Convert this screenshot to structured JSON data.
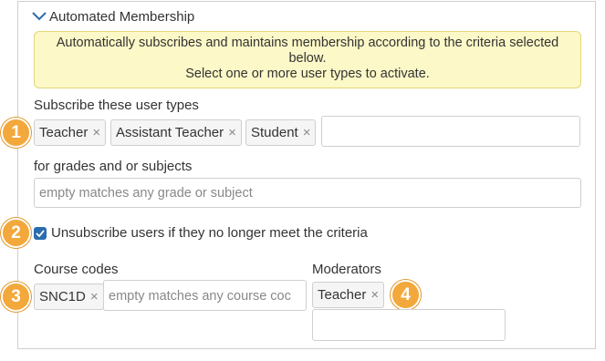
{
  "section": {
    "title": "Automated Membership"
  },
  "info": {
    "line1": "Automatically subscribes and maintains membership according to the criteria selected",
    "line2": "below.",
    "line3": "Select one or more user types to activate."
  },
  "user_types": {
    "label": "Subscribe these user types",
    "tags": [
      "Teacher",
      "Assistant Teacher",
      "Student"
    ]
  },
  "grades": {
    "label": "for grades and or subjects",
    "placeholder": "empty matches any grade or subject"
  },
  "unsubscribe": {
    "label": "Unsubscribe users if they no longer meet the criteria",
    "checked": true
  },
  "course_codes": {
    "label": "Course codes",
    "tags": [
      "SNC1D"
    ],
    "placeholder": "empty matches any course coc"
  },
  "moderators": {
    "label": "Moderators",
    "tags": [
      "Teacher"
    ]
  },
  "callouts": [
    "1",
    "2",
    "3",
    "4"
  ],
  "remove_symbol": "×",
  "colors": {
    "callout": "#f3a83b",
    "info_bg": "#fcf8c7",
    "checkbox": "#2b6cb0",
    "chevron": "#2b6cb0"
  }
}
